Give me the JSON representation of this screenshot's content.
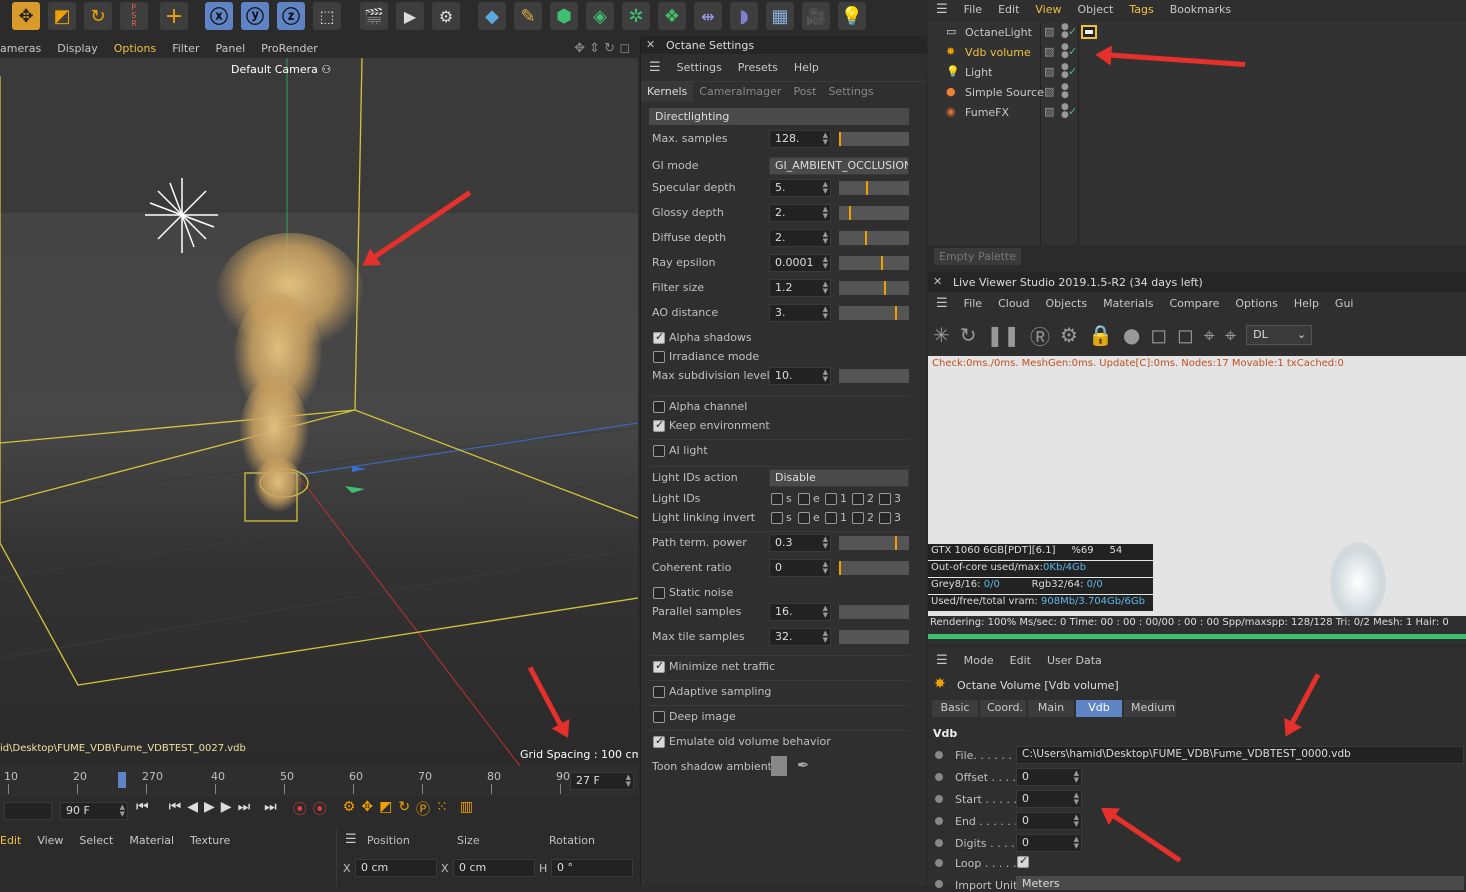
{
  "viewport": {
    "menu": [
      "ameras",
      "Display",
      "Options",
      "Filter",
      "Panel",
      "ProRender"
    ],
    "camera_label": "Default Camera",
    "path_text": "id\\Desktop\\FUME_VDB\\Fume_VDBTEST_0027.vdb",
    "grid_spacing": "Grid Spacing : 100 cm"
  },
  "timeline": {
    "ticks": [
      "10",
      "20",
      "270",
      "40",
      "50",
      "60",
      "70",
      "80",
      "90"
    ],
    "end_frame": "27 F",
    "min_field": "90 F"
  },
  "bottom_left_menu": [
    "Edit",
    "View",
    "Select",
    "Material",
    "Texture"
  ],
  "coords": {
    "headers": [
      "Position",
      "Size",
      "Rotation"
    ],
    "x_label": "X",
    "x_pos": "0 cm",
    "x2_label": "X",
    "x_size": "0 cm",
    "h_label": "H",
    "h_rot": "0 °"
  },
  "octane": {
    "title": "Octane Settings",
    "menu": [
      "Settings",
      "Presets",
      "Help"
    ],
    "tabs": [
      "Kernels",
      "CameraImager",
      "Post",
      "Settings"
    ],
    "kernel": "Directlighting",
    "rows": [
      {
        "label": "Max. samples",
        "value": "128.",
        "fill": 0.0
      },
      {
        "label": "GI mode",
        "value": "GI_AMBIENT_OCCLUSION"
      },
      {
        "label": "Specular depth",
        "value": "5.",
        "fill": 0.4
      },
      {
        "label": "Glossy depth",
        "value": "2.",
        "fill": 0.15
      },
      {
        "label": "Diffuse depth",
        "value": "2.",
        "fill": 0.38
      },
      {
        "label": "Ray epsilon",
        "value": "0.0001",
        "fill": 0.62
      },
      {
        "label": "Filter size",
        "value": "1.2",
        "fill": 0.66
      },
      {
        "label": "AO distance",
        "value": "3.",
        "fill": 0.82
      }
    ],
    "checks1": [
      {
        "label": "Alpha shadows",
        "on": true
      },
      {
        "label": "Irradiance mode",
        "on": false
      }
    ],
    "max_subdiv": {
      "label": "Max subdivision level",
      "value": "10."
    },
    "checks2": [
      {
        "label": "Alpha channel",
        "on": false
      },
      {
        "label": "Keep environment",
        "on": true
      }
    ],
    "ai_light": {
      "label": "AI light",
      "on": false
    },
    "light_ids_action": {
      "label": "Light IDs action",
      "value": "Disable"
    },
    "light_ids": {
      "label": "Light IDs",
      "opts": [
        "s",
        "e",
        "1",
        "2",
        "3"
      ]
    },
    "light_link": {
      "label": "Light linking invert",
      "opts": [
        "s",
        "e",
        "1",
        "2",
        "3"
      ]
    },
    "path_term": {
      "label": "Path term. power",
      "value": "0.3",
      "fill": 0.82
    },
    "coherent": {
      "label": "Coherent ratio",
      "value": "0",
      "fill": 0.0
    },
    "static_noise": {
      "label": "Static noise",
      "on": false
    },
    "parallel": {
      "label": "Parallel samples",
      "value": "16."
    },
    "max_tile": {
      "label": "Max tile samples",
      "value": "32."
    },
    "checks3": [
      {
        "label": "Minimize net traffic",
        "on": true
      },
      {
        "label": "Adaptive sampling",
        "on": false
      },
      {
        "label": "Deep image",
        "on": false
      },
      {
        "label": "Emulate old volume behavior",
        "on": true
      }
    ],
    "toon": "Toon shadow ambient"
  },
  "objects": {
    "menu": [
      "File",
      "Edit",
      "View",
      "Object",
      "Tags",
      "Bookmarks"
    ],
    "items": [
      "OctaneLight",
      "Vdb volume",
      "Light",
      "Simple Source",
      "FumeFX"
    ],
    "palette": "Empty Palette"
  },
  "live": {
    "title": "Live Viewer Studio 2019.1.5-R2 (34 days left)",
    "menu": [
      "File",
      "Cloud",
      "Objects",
      "Materials",
      "Compare",
      "Options",
      "Help",
      "Gui"
    ],
    "mode": "DL",
    "check": "Check:0ms./0ms. MeshGen:0ms. Update[C]:0ms. Nodes:17 Movable:1 txCached:0",
    "gpu": "GTX 1060 6GB[PDT][6.1]",
    "gpu_pct": "%69",
    "gpu_temp": "54",
    "ooc_label": "Out-of-core used/max:",
    "ooc_val": "0Kb/4Gb",
    "grey_label": "Grey8/16: ",
    "grey_val": "0/0",
    "rgb_label": "Rgb32/64: ",
    "rgb_val": "0/0",
    "vram_label": "Used/free/total vram: ",
    "vram_val": "908Mb/3.704Gb/6Gb",
    "status": "Rendering: 100% Ms/sec: 0   Time: 00 : 00 : 00/00 : 00 : 00  Spp/maxspp: 128/128   Tri: 0/2   Mesh: 1  Hair: 0",
    "progress": 1.0
  },
  "attr": {
    "menu": [
      "Mode",
      "Edit",
      "User Data"
    ],
    "object": "Octane Volume [Vdb volume]",
    "tabs": [
      "Basic",
      "Coord.",
      "Main",
      "Vdb",
      "Medium"
    ],
    "section": "Vdb",
    "file_label": "File. . . . . .",
    "file": "C:\\Users\\hamid\\Desktop\\FUME_VDB\\Fume_VDBTEST_0000.vdb",
    "fields": [
      {
        "label": "Offset . . . .",
        "value": "0"
      },
      {
        "label": "Start . . . . .",
        "value": "0"
      },
      {
        "label": "End . . . . . .",
        "value": "0"
      },
      {
        "label": "Digits . . . .",
        "value": "0"
      }
    ],
    "loop": "Loop . . . . .",
    "import_label": "Import Unit",
    "import_value": "Meters"
  },
  "colors": {
    "accent": "#5f84c6",
    "orange": "#f0a000",
    "arrow": "#e5302b",
    "grid_yellow": "#d4c43a"
  }
}
